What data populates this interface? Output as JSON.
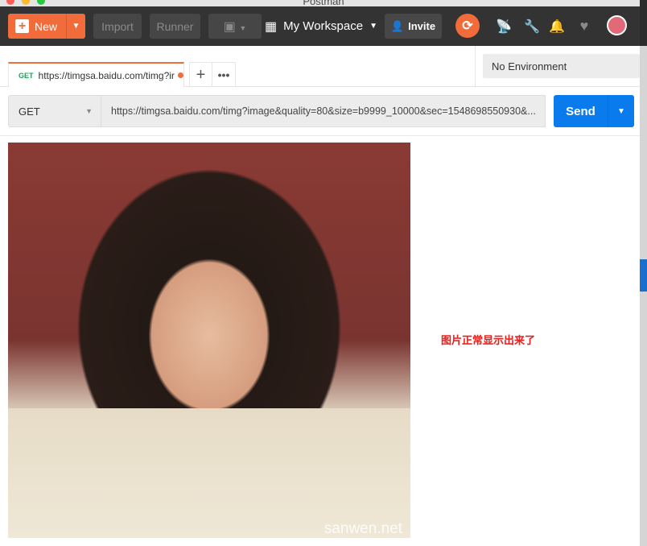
{
  "window_title": "Postman",
  "toolbar": {
    "new_label": "New",
    "import_label": "Import",
    "runner_label": "Runner",
    "workspace_label": "My Workspace",
    "invite_label": "Invite"
  },
  "tabs": [
    {
      "method": "GET",
      "label": "https://timgsa.baidu.com/timg?ir"
    }
  ],
  "environment": {
    "selected": "No Environment"
  },
  "request": {
    "method": "GET",
    "url": "https://timgsa.baidu.com/timg?image&quality=80&size=b9999_10000&sec=1548698550930&...",
    "send_label": "Send"
  },
  "response": {
    "watermark": "sanwen.net",
    "annotation": "图片正常显示出来了"
  },
  "colors": {
    "accent": "#f26b3a",
    "send": "#097bed",
    "annotation": "#e8231f"
  }
}
